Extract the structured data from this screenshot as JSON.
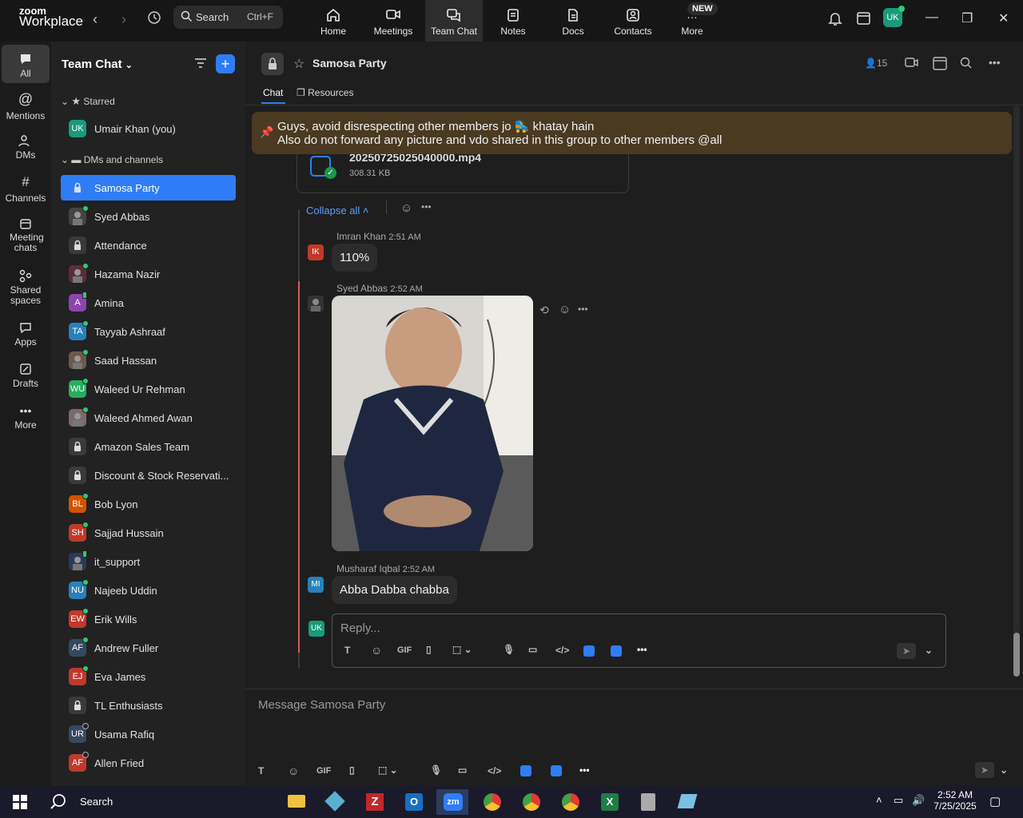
{
  "app": {
    "brand_small": "zoom",
    "brand_big": "Workplace"
  },
  "topbar": {
    "search_label": "Search",
    "search_shortcut": "Ctrl+F",
    "tabs": [
      {
        "label": "Home"
      },
      {
        "label": "Meetings"
      },
      {
        "label": "Team Chat"
      },
      {
        "label": "Notes"
      },
      {
        "label": "Docs"
      },
      {
        "label": "Contacts"
      },
      {
        "label": "More"
      }
    ],
    "new_badge": "NEW",
    "user_initials": "UK"
  },
  "rail": {
    "items": [
      {
        "label": "All"
      },
      {
        "label": "Mentions"
      },
      {
        "label": "DMs"
      },
      {
        "label": "Channels"
      },
      {
        "label": "Meeting chats"
      },
      {
        "label": "Shared spaces"
      },
      {
        "label": "Apps"
      },
      {
        "label": "Drafts"
      },
      {
        "label": "More"
      }
    ]
  },
  "sidebar": {
    "title": "Team Chat",
    "starred_header": "Starred",
    "dms_header": "DMs and channels",
    "starred": [
      {
        "name": "Umair Khan (you)",
        "initials": "UK",
        "color": "#1a9a7a"
      }
    ],
    "items": [
      {
        "name": "Samosa Party",
        "initials": "",
        "color": "#2f7df6",
        "type": "lock"
      },
      {
        "name": "Syed Abbas",
        "initials": "",
        "color": "#444",
        "type": "photo",
        "status": "online"
      },
      {
        "name": "Attendance",
        "initials": "",
        "color": "#3a3a3a",
        "type": "lock"
      },
      {
        "name": "Hazama Nazir",
        "initials": "",
        "color": "#5a2e3a",
        "type": "photo",
        "status": "online"
      },
      {
        "name": "Amina",
        "initials": "A",
        "color": "#8e44ad",
        "status": "mobile"
      },
      {
        "name": "Tayyab Ashraaf",
        "initials": "TA",
        "color": "#2980b9",
        "status": "online"
      },
      {
        "name": "Saad Hassan",
        "initials": "",
        "color": "#6b5a4a",
        "type": "photo",
        "status": "online"
      },
      {
        "name": "Waleed Ur Rehman",
        "initials": "WU",
        "color": "#27ae60",
        "status": "online"
      },
      {
        "name": "Waleed Ahmed Awan",
        "initials": "",
        "color": "#7a6a6a",
        "type": "photo",
        "status": "online"
      },
      {
        "name": "Amazon Sales Team",
        "initials": "",
        "color": "#3a3a3a",
        "type": "lock"
      },
      {
        "name": "Discount & Stock Reservati...",
        "initials": "",
        "color": "#3a3a3a",
        "type": "lock"
      },
      {
        "name": "Bob Lyon",
        "initials": "BL",
        "color": "#d35400",
        "status": "online"
      },
      {
        "name": "Sajjad Hussain",
        "initials": "SH",
        "color": "#c0392b",
        "status": "online"
      },
      {
        "name": "it_support",
        "initials": "",
        "color": "#2a3a5a",
        "type": "photo",
        "status": "mobile"
      },
      {
        "name": "Najeeb Uddin",
        "initials": "NU",
        "color": "#2980b9",
        "status": "online"
      },
      {
        "name": "Erik Wills",
        "initials": "EW",
        "color": "#c0392b",
        "status": "online"
      },
      {
        "name": "Andrew Fuller",
        "initials": "AF",
        "color": "#34495e",
        "status": "online"
      },
      {
        "name": "Eva James",
        "initials": "EJ",
        "color": "#c0392b",
        "status": "online"
      },
      {
        "name": "TL Enthusiasts",
        "initials": "",
        "color": "#3a3a3a",
        "type": "lock"
      },
      {
        "name": "Usama Rafiq",
        "initials": "UR",
        "color": "#34495e",
        "status": "offline"
      },
      {
        "name": "Allen Fried",
        "initials": "AF",
        "color": "#c0392b",
        "status": "offline"
      }
    ]
  },
  "channel": {
    "title": "Samosa Party",
    "member_count": "15",
    "tabs": [
      {
        "label": "Chat"
      },
      {
        "label": "Resources"
      }
    ],
    "pinned_line1": "Guys, avoid disrespecting other members jo 🛼 khatay hain",
    "pinned_line2": "Also do not forward any picture and vdo shared in this group to other members @all",
    "file_name": "20250725025040000.mp4",
    "file_size": "308.31 KB",
    "collapse_label": "Collapse all",
    "messages": [
      {
        "author": "Imran Khan",
        "time": "2:51 AM",
        "text": "110%",
        "initials": "IK",
        "color": "#c0392b"
      },
      {
        "author": "Syed Abbas",
        "time": "2:52 AM",
        "text": "",
        "initials": "",
        "color": "#333"
      },
      {
        "author": "Musharaf Iqbal",
        "time": "2:52 AM",
        "text": "Abba Dabba chabba",
        "initials": "MI",
        "color": "#2980b9"
      }
    ],
    "reply_placeholder": "Reply...",
    "reply_initials": "UK",
    "composer_placeholder": "Message Samosa Party",
    "gif_label": "GIF"
  },
  "taskbar": {
    "search_label": "Search",
    "time": "2:52 AM",
    "date": "7/25/2025"
  }
}
